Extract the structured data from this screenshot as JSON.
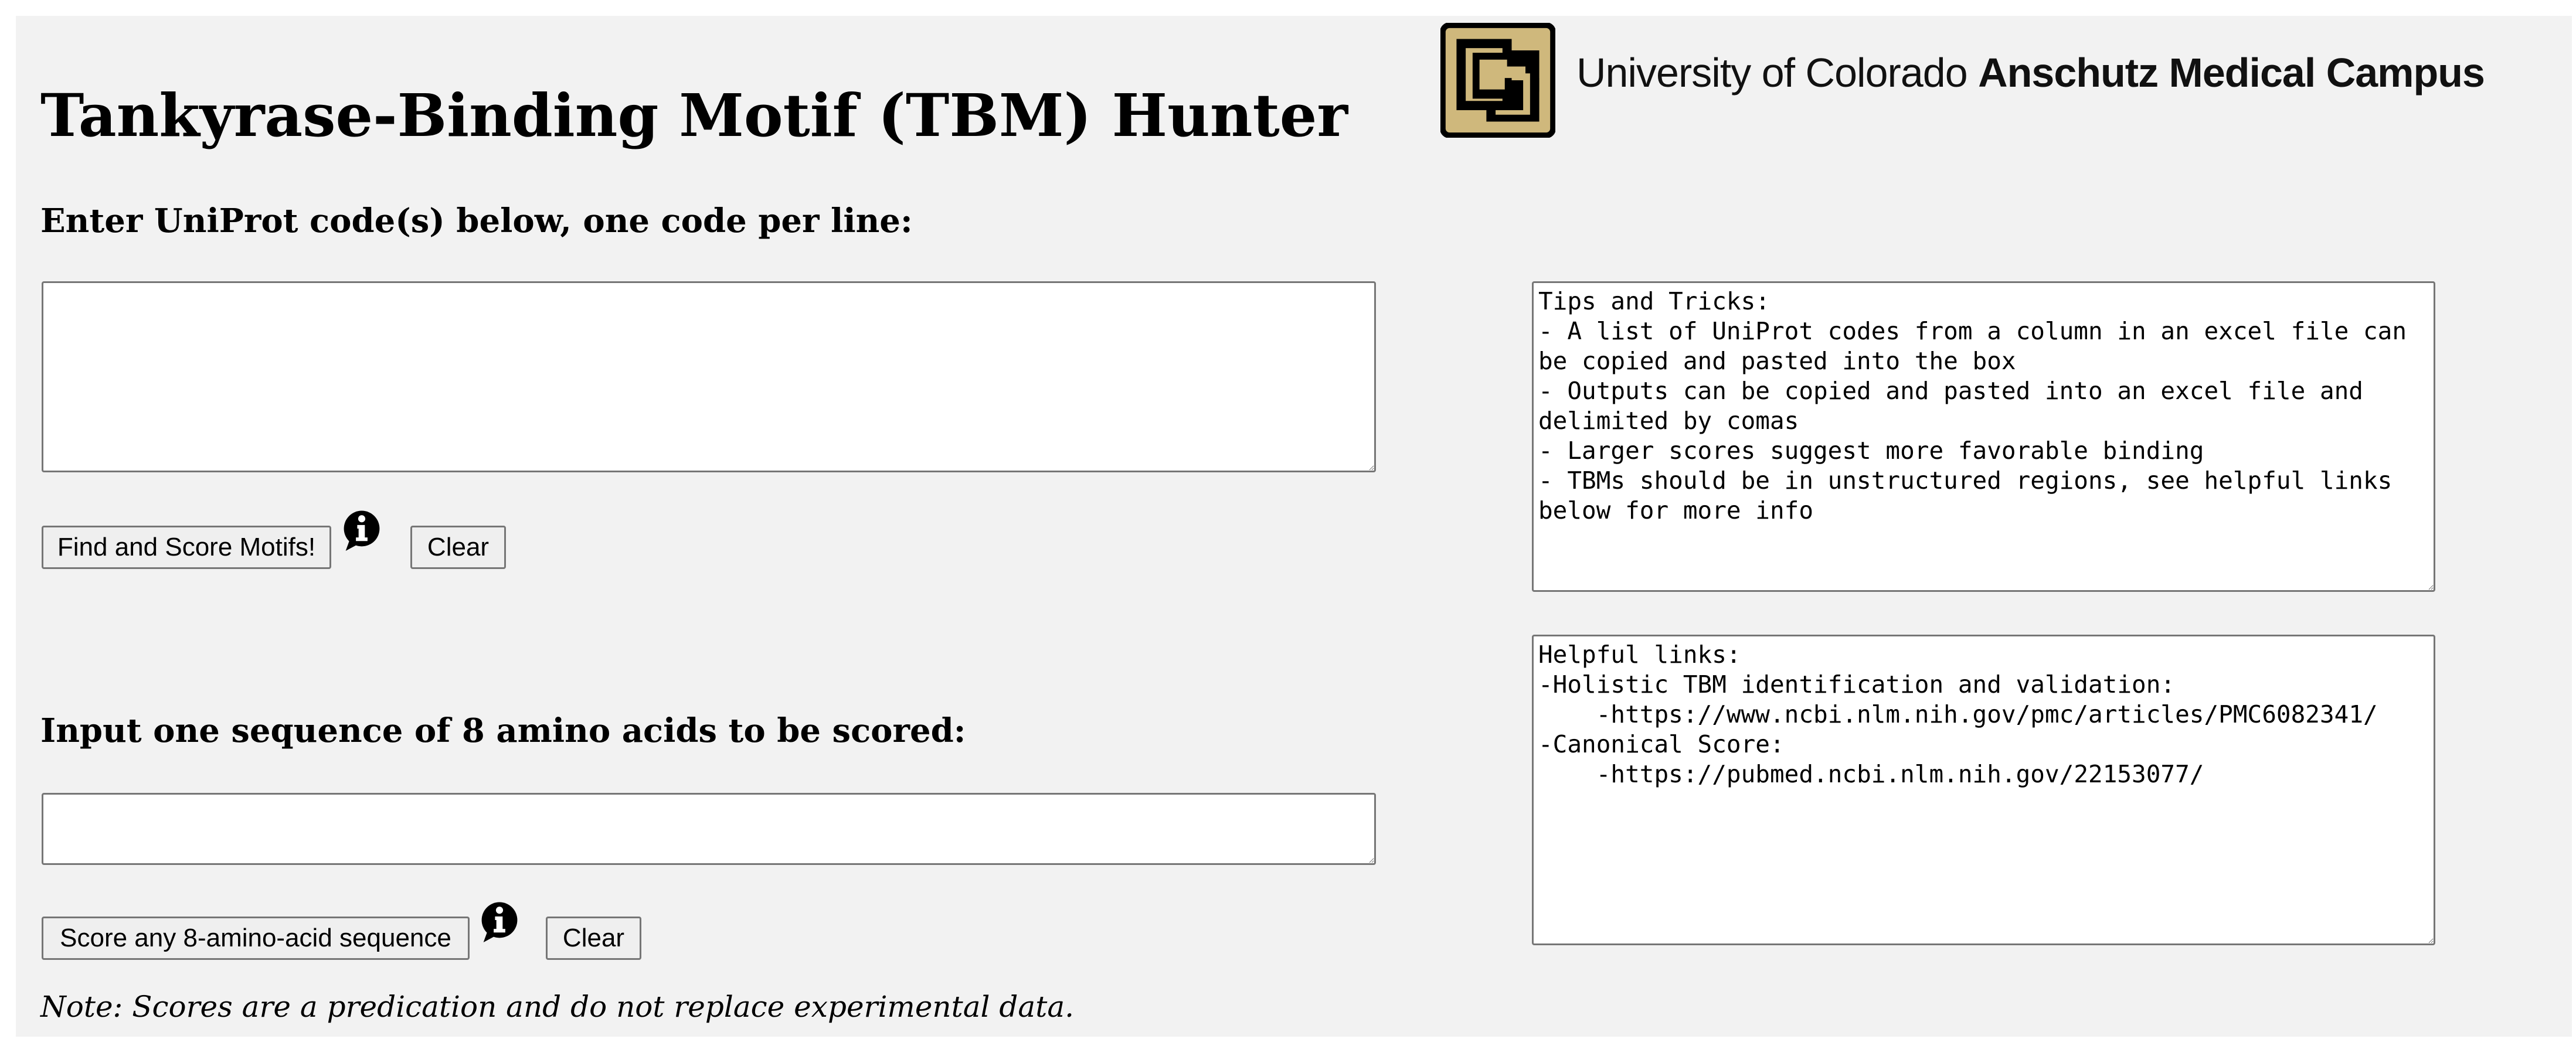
{
  "header": {
    "title": "Tankyrase-Binding Motif (TBM) Hunter",
    "logo": {
      "text_regular": "University of Colorado",
      "text_bold": "Anschutz Medical Campus",
      "icon": "cu-logo-icon",
      "colors": {
        "gold": "#cfb87c",
        "black": "#000000"
      }
    }
  },
  "uniprot_section": {
    "label": "Enter UniProt code(s) below, one code per line:",
    "input_value": "",
    "find_button": "Find and Score Motifs!",
    "clear_button": "Clear",
    "info_icon": "info-icon"
  },
  "sequence_section": {
    "label": "Input one sequence of 8 amino acids to be scored:",
    "input_value": "",
    "score_button": "Score any 8-amino-acid sequence",
    "clear_button": "Clear",
    "info_icon": "info-icon"
  },
  "note": "Note: Scores are a predication and do not replace experimental data.",
  "tips_box": {
    "text": "Tips and Tricks:\n- A list of UniProt codes from a column in an excel file can be copied and pasted into the box\n- Outputs can be copied and pasted into an excel file and delimited by comas\n- Larger scores suggest more favorable binding\n- TBMs should be in unstructured regions, see helpful links below for more info"
  },
  "links_box": {
    "text": "Helpful links:\n-Holistic TBM identification and validation:\n    -https://www.ncbi.nlm.nih.gov/pmc/articles/PMC6082341/\n-Canonical Score:\n    -https://pubmed.ncbi.nlm.nih.gov/22153077/"
  },
  "colors": {
    "page_background": "#f2f2f2",
    "button_background": "#efefef",
    "border": "#767676"
  }
}
